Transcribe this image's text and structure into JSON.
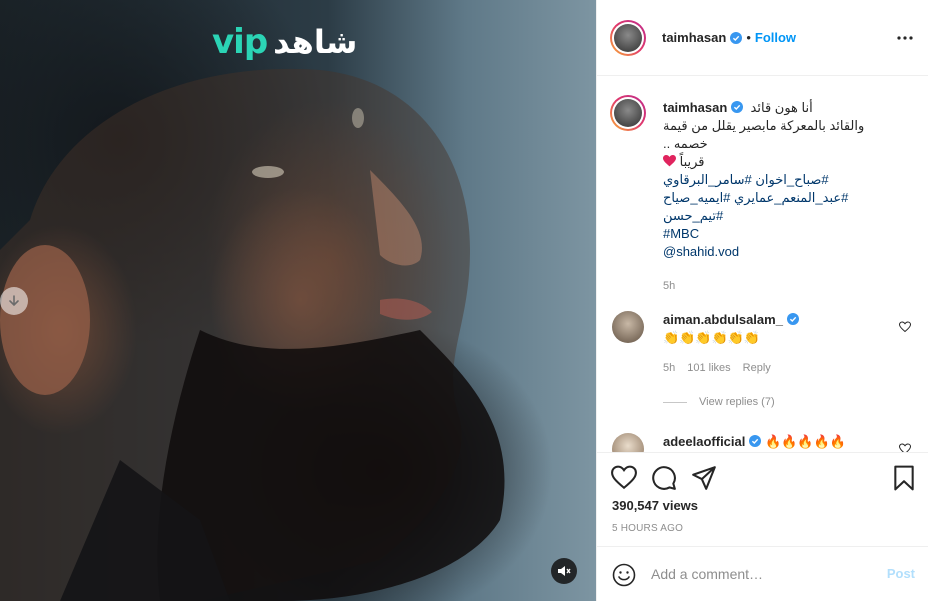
{
  "media": {
    "brand_text_latin": "vip",
    "brand_text_arabic": "شاهد",
    "nav_icon": "chevron-down-icon",
    "mute_icon": "speaker-muted-icon"
  },
  "header": {
    "username": "taimhasan",
    "dot": "•",
    "follow_label": "Follow",
    "more_icon": "more-horizontal-icon"
  },
  "caption": {
    "username": "taimhasan",
    "lines": [
      "أنا هون قائد",
      "والقائد بالمعركة مابصير يقلل من قيمة",
      "خصمه ..",
      "قريباً",
      "#صباح_اخوان #سامر_البرقاوي",
      "#عبد_المنعم_عمايري #ايميه_صياح",
      "#تيم_حسن",
      "#MBC",
      "@shahid.vod"
    ],
    "time": "5h"
  },
  "comments": [
    {
      "username": "aiman.abdulsalam_",
      "text": "👏👏👏👏👏👏",
      "time": "5h",
      "likes": "101 likes",
      "reply_label": "Reply",
      "view_replies": "View replies (7)"
    },
    {
      "username": "adeelaofficial",
      "text": "🔥🔥🔥🔥🔥"
    }
  ],
  "actions": {
    "views": "390,547 views",
    "time_ago": "5 HOURS AGO"
  },
  "comment_box": {
    "placeholder": "Add a comment…",
    "post_label": "Post"
  },
  "colors": {
    "accent": "#0095f6",
    "brand_teal": "#2bd4b5",
    "heart_red": "#e0245e"
  }
}
